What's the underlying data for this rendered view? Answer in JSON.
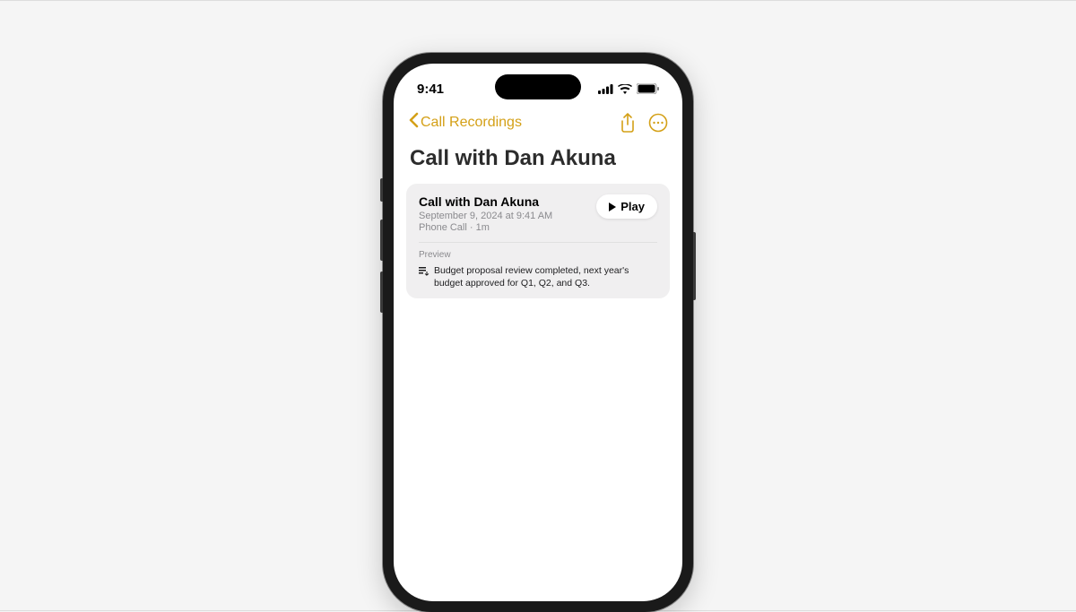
{
  "status_bar": {
    "time": "9:41"
  },
  "nav": {
    "back_label": "Call Recordings"
  },
  "page": {
    "title": "Call with Dan Akuna"
  },
  "recording": {
    "title": "Call with Dan Akuna",
    "date": "September 9, 2024 at 9:41 AM",
    "meta": "Phone Call · 1m",
    "play_label": "Play",
    "preview_label": "Preview",
    "preview_text": "Budget proposal review completed, next year's budget approved for Q1, Q2, and Q3."
  }
}
